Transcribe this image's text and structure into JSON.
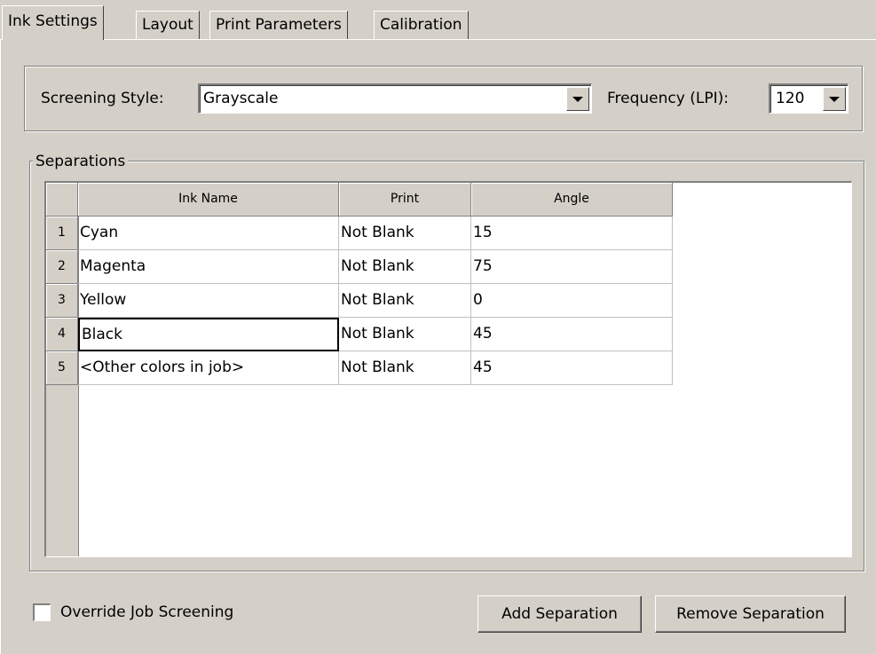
{
  "tabs": [
    {
      "label": "Ink Settings",
      "active": true
    },
    {
      "label": "Layout"
    },
    {
      "label": "Print Parameters"
    },
    {
      "label": "Calibration"
    }
  ],
  "screening": {
    "style_label": "Screening Style:",
    "style_value": "Grayscale",
    "frequency_label": "Frequency (LPI):",
    "frequency_value": "120"
  },
  "separations": {
    "group_label": "Separations",
    "columns": [
      "Ink Name",
      "Print",
      "Angle"
    ],
    "rows": [
      {
        "num": "1",
        "ink": "Cyan",
        "print": "Not Blank",
        "angle": "15"
      },
      {
        "num": "2",
        "ink": "Magenta",
        "print": "Not Blank",
        "angle": "75"
      },
      {
        "num": "3",
        "ink": "Yellow",
        "print": "Not Blank",
        "angle": "0"
      },
      {
        "num": "4",
        "ink": "Black",
        "print": "Not Blank",
        "angle": "45"
      },
      {
        "num": "5",
        "ink": "<Other colors in job>",
        "print": "Not Blank",
        "angle": "45"
      }
    ]
  },
  "override": {
    "label": "Override Job Screening",
    "checked": false
  },
  "buttons": {
    "add": "Add Separation",
    "remove": "Remove Separation"
  },
  "colors": {
    "face": "#d4d0c8",
    "shadow": "#808080",
    "highlight": "#ffffff",
    "window": "#ffffff"
  }
}
